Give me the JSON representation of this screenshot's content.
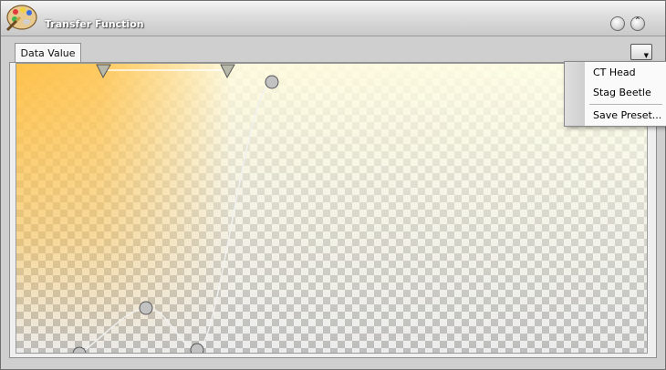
{
  "window": {
    "title": "Transfer Function"
  },
  "tabs": [
    {
      "label": "Data Value",
      "active": true
    }
  ],
  "colors": {
    "ramp": "#ffa500",
    "curve": "#f2f2f2",
    "marker": "#b8b8aa"
  },
  "preset_menu": {
    "items": [
      {
        "label": "CT Head"
      },
      {
        "label": "Stag Beetle"
      },
      {
        "label": "Save Preset..."
      }
    ]
  },
  "icons": {
    "app": "palette-icon",
    "minimize": "circle-button-icon",
    "collapse": "chevron-up-icon",
    "menu": "dropdown-arrow-icon",
    "marker": "triangle-down-icon",
    "node": "circle-node-icon"
  }
}
